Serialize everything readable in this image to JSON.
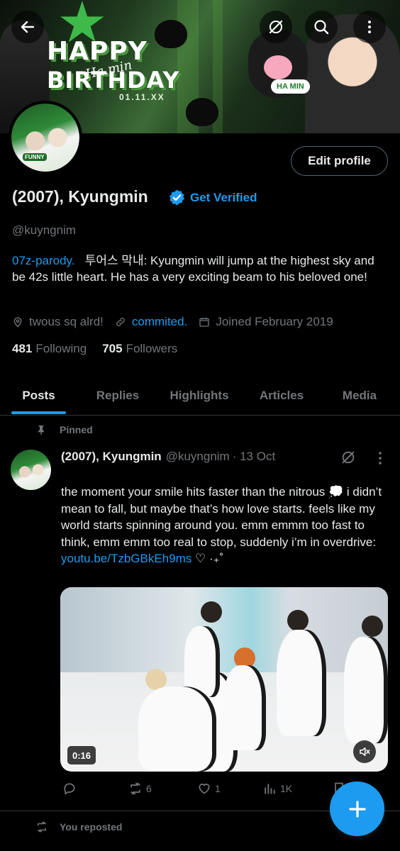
{
  "banner": {
    "line1": "HAPPY",
    "line2": "BIRTHDAY",
    "script": "Ha.min",
    "date": "01.11.XX",
    "tag": "HA MIN"
  },
  "avatar": {
    "label": "FUNNY"
  },
  "profile": {
    "edit_label": "Edit profile",
    "display_name": "(2007), Kyungmin",
    "get_verified": "Get Verified",
    "handle": "@kuyngnim",
    "bio_link": "07z-parody.",
    "bio_text": "투어스 막내: Kyungmin will  jump at the highest sky and be 42s little heart. He has a very exciting beam to his beloved one!",
    "location": "twous sq alrd!",
    "website": "commited.",
    "joined": "Joined February 2019",
    "following_count": "481",
    "following_label": "Following",
    "followers_count": "705",
    "followers_label": "Followers"
  },
  "tabs": [
    "Posts",
    "Replies",
    "Highlights",
    "Articles",
    "Media"
  ],
  "post": {
    "pinned_label": "Pinned",
    "name": "(2007), Kyungmin",
    "handle": "@kuyngnim",
    "time": "· 13 Oct",
    "text": "the moment your smile hits faster than the nitrous 💭 i didn’t mean to fall, but maybe that’s how love starts. feels like my world starts spinning around you. emm emmm too fast to think, emm emm too real to stop, suddenly i’m in overdrive: ",
    "link": "youtu.be/TzbGBkEh9ms",
    "trail": " ♡ ·₊˚",
    "video_time": "0:16",
    "reply_count": "",
    "repost_count": "6",
    "like_count": "1",
    "view_count": "1K"
  },
  "next": {
    "reposted_label": "You reposted"
  },
  "colors": {
    "accent": "#1d9bf0",
    "background": "#000000",
    "muted": "#71767b",
    "text": "#e7e9ea"
  },
  "icons": [
    "back-arrow-icon",
    "grok-icon",
    "search-icon",
    "more-vertical-icon",
    "verified-badge-icon",
    "location-icon",
    "link-icon",
    "calendar-icon",
    "pin-icon",
    "reply-icon",
    "repost-icon",
    "like-icon",
    "views-icon",
    "bookmark-icon",
    "share-icon",
    "mute-icon",
    "plus-icon"
  ]
}
